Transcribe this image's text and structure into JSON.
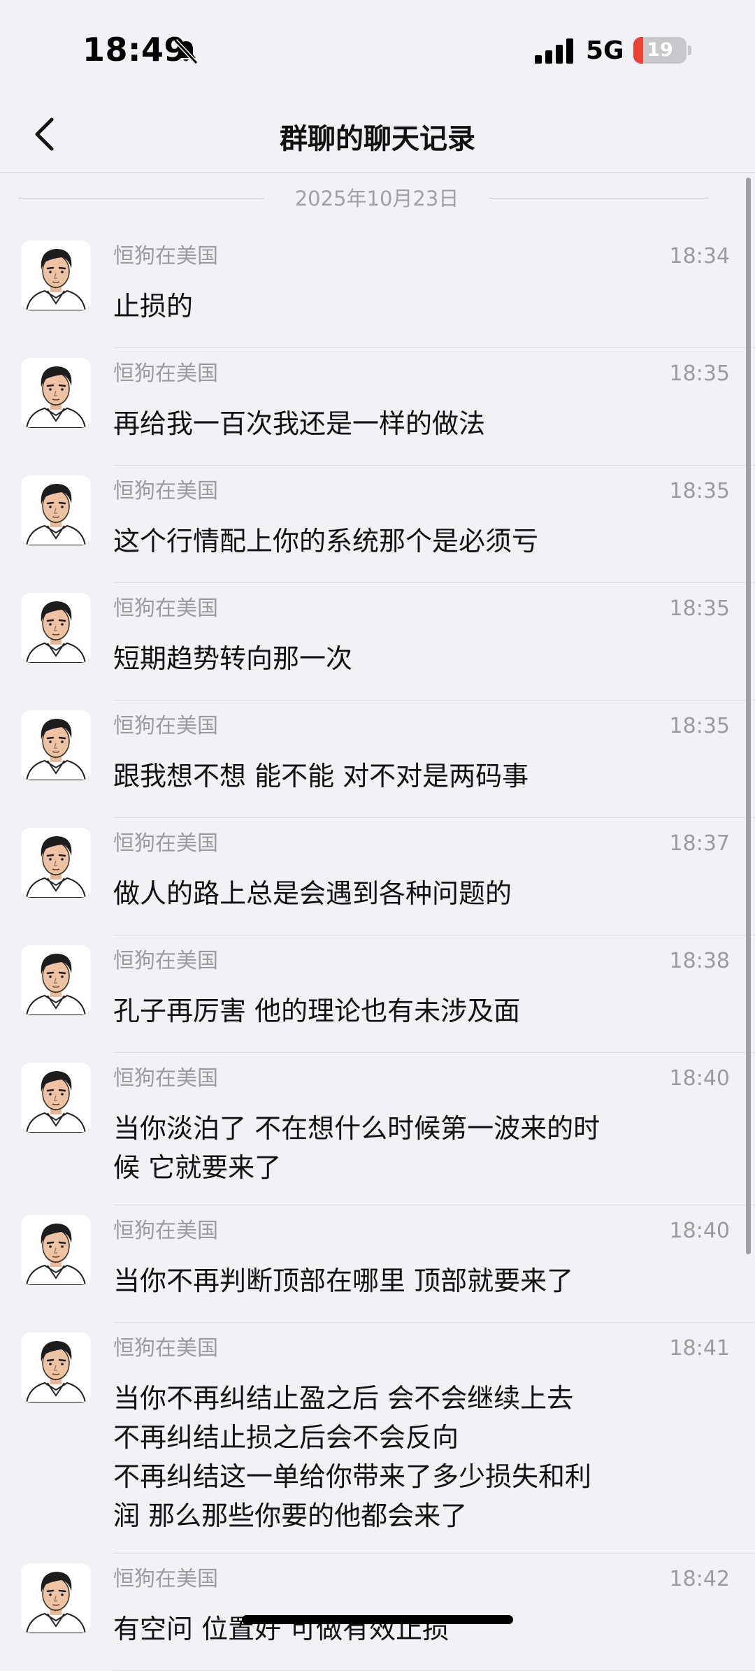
{
  "status_bar": {
    "time": "18:49",
    "network": "5G",
    "battery_level": 19,
    "battery_text": "19",
    "bell_icon": "bell-slash-icon",
    "signal_icon": "cellular-signal-icon",
    "battery_color": "#ea4335"
  },
  "nav": {
    "title": "群聊的聊天记录",
    "back_icon": "chevron-left-icon"
  },
  "date_divider": "2025年10月23日",
  "messages": [
    {
      "sender": "恒狗在美国",
      "time": "18:34",
      "text": "止损的"
    },
    {
      "sender": "恒狗在美国",
      "time": "18:35",
      "text": "再给我一百次我还是一样的做法"
    },
    {
      "sender": "恒狗在美国",
      "time": "18:35",
      "text": "这个行情配上你的系统那个是必须亏"
    },
    {
      "sender": "恒狗在美国",
      "time": "18:35",
      "text": "短期趋势转向那一次"
    },
    {
      "sender": "恒狗在美国",
      "time": "18:35",
      "text": "跟我想不想  能不能  对不对是两码事"
    },
    {
      "sender": "恒狗在美国",
      "time": "18:37",
      "text": "做人的路上总是会遇到各种问题的"
    },
    {
      "sender": "恒狗在美国",
      "time": "18:38",
      "text": "孔子再厉害 他的理论也有未涉及面"
    },
    {
      "sender": "恒狗在美国",
      "time": "18:40",
      "text": "当你淡泊了 不在想什么时候第一波来的时\n候  它就要来了"
    },
    {
      "sender": "恒狗在美国",
      "time": "18:40",
      "text": "当你不再判断顶部在哪里  顶部就要来了"
    },
    {
      "sender": "恒狗在美国",
      "time": "18:41",
      "text": "当你不再纠结止盈之后 会不会继续上去\n不再纠结止损之后会不会反向\n不再纠结这一单给你带来了多少损失和利\n润  那么那些你要的他都会来了"
    },
    {
      "sender": "恒狗在美国",
      "time": "18:42",
      "text": "有空问 位置好 可做有效止损"
    }
  ]
}
